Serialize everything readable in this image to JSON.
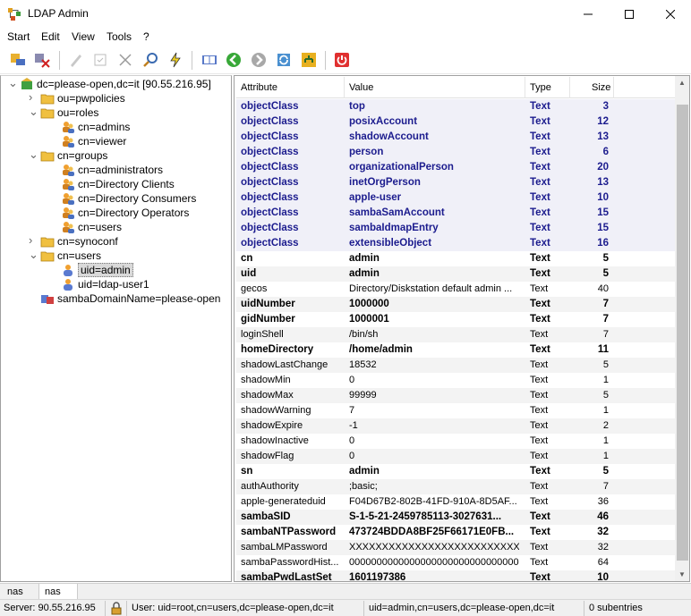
{
  "window": {
    "title": "LDAP Admin"
  },
  "menu": [
    "Start",
    "Edit",
    "View",
    "Tools",
    "?"
  ],
  "tree": [
    {
      "label": "dc=please-open,dc=it [90.55.216.95]",
      "level": 0,
      "toggle": "v",
      "icon": "domain-icon"
    },
    {
      "label": "ou=pwpolicies",
      "level": 1,
      "toggle": ">",
      "icon": "folder-icon"
    },
    {
      "label": "ou=roles",
      "level": 1,
      "toggle": "v",
      "icon": "folder-icon"
    },
    {
      "label": "cn=admins",
      "level": 2,
      "toggle": "",
      "icon": "group-icon"
    },
    {
      "label": "cn=viewer",
      "level": 2,
      "toggle": "",
      "icon": "group-icon"
    },
    {
      "label": "cn=groups",
      "level": 1,
      "toggle": "v",
      "icon": "folder-icon"
    },
    {
      "label": "cn=administrators",
      "level": 2,
      "toggle": "",
      "icon": "group-icon"
    },
    {
      "label": "cn=Directory Clients",
      "level": 2,
      "toggle": "",
      "icon": "group-icon"
    },
    {
      "label": "cn=Directory Consumers",
      "level": 2,
      "toggle": "",
      "icon": "group-icon"
    },
    {
      "label": "cn=Directory Operators",
      "level": 2,
      "toggle": "",
      "icon": "group-icon"
    },
    {
      "label": "cn=users",
      "level": 2,
      "toggle": "",
      "icon": "group-icon"
    },
    {
      "label": "cn=synoconf",
      "level": 1,
      "toggle": ">",
      "icon": "folder-icon"
    },
    {
      "label": "cn=users",
      "level": 1,
      "toggle": "v",
      "icon": "folder-icon"
    },
    {
      "label": "uid=admin",
      "level": 2,
      "toggle": "",
      "icon": "user-icon",
      "selected": true
    },
    {
      "label": "uid=ldap-user1",
      "level": 2,
      "toggle": "",
      "icon": "user-icon"
    },
    {
      "label": "sambaDomainName=please-open",
      "level": 1,
      "toggle": "",
      "icon": "samba-icon"
    }
  ],
  "grid": {
    "headers": {
      "attribute": "Attribute",
      "value": "Value",
      "type": "Type",
      "size": "Size"
    },
    "rows": [
      {
        "a": "objectClass",
        "v": "top",
        "t": "Text",
        "s": "3",
        "k": "oc"
      },
      {
        "a": "objectClass",
        "v": "posixAccount",
        "t": "Text",
        "s": "12",
        "k": "oc"
      },
      {
        "a": "objectClass",
        "v": "shadowAccount",
        "t": "Text",
        "s": "13",
        "k": "oc"
      },
      {
        "a": "objectClass",
        "v": "person",
        "t": "Text",
        "s": "6",
        "k": "oc"
      },
      {
        "a": "objectClass",
        "v": "organizationalPerson",
        "t": "Text",
        "s": "20",
        "k": "oc"
      },
      {
        "a": "objectClass",
        "v": "inetOrgPerson",
        "t": "Text",
        "s": "13",
        "k": "oc"
      },
      {
        "a": "objectClass",
        "v": "apple-user",
        "t": "Text",
        "s": "10",
        "k": "oc"
      },
      {
        "a": "objectClass",
        "v": "sambaSamAccount",
        "t": "Text",
        "s": "15",
        "k": "oc"
      },
      {
        "a": "objectClass",
        "v": "sambaIdmapEntry",
        "t": "Text",
        "s": "15",
        "k": "oc"
      },
      {
        "a": "objectClass",
        "v": "extensibleObject",
        "t": "Text",
        "s": "16",
        "k": "oc"
      },
      {
        "a": "cn",
        "v": "admin",
        "t": "Text",
        "s": "5",
        "k": "bold"
      },
      {
        "a": "uid",
        "v": "admin",
        "t": "Text",
        "s": "5",
        "k": "bold"
      },
      {
        "a": "gecos",
        "v": "Directory/Diskstation default admin ...",
        "t": "Text",
        "s": "40",
        "k": "normal"
      },
      {
        "a": "uidNumber",
        "v": "1000000",
        "t": "Text",
        "s": "7",
        "k": "bold"
      },
      {
        "a": "gidNumber",
        "v": "1000001",
        "t": "Text",
        "s": "7",
        "k": "bold"
      },
      {
        "a": "loginShell",
        "v": "/bin/sh",
        "t": "Text",
        "s": "7",
        "k": "normal"
      },
      {
        "a": "homeDirectory",
        "v": "/home/admin",
        "t": "Text",
        "s": "11",
        "k": "bold"
      },
      {
        "a": "shadowLastChange",
        "v": "18532",
        "t": "Text",
        "s": "5",
        "k": "normal"
      },
      {
        "a": "shadowMin",
        "v": "0",
        "t": "Text",
        "s": "1",
        "k": "normal"
      },
      {
        "a": "shadowMax",
        "v": "99999",
        "t": "Text",
        "s": "5",
        "k": "normal"
      },
      {
        "a": "shadowWarning",
        "v": "7",
        "t": "Text",
        "s": "1",
        "k": "normal"
      },
      {
        "a": "shadowExpire",
        "v": "-1",
        "t": "Text",
        "s": "2",
        "k": "normal"
      },
      {
        "a": "shadowInactive",
        "v": "0",
        "t": "Text",
        "s": "1",
        "k": "normal"
      },
      {
        "a": "shadowFlag",
        "v": "0",
        "t": "Text",
        "s": "1",
        "k": "normal"
      },
      {
        "a": "sn",
        "v": "admin",
        "t": "Text",
        "s": "5",
        "k": "bold"
      },
      {
        "a": "authAuthority",
        "v": ";basic;",
        "t": "Text",
        "s": "7",
        "k": "normal"
      },
      {
        "a": "apple-generateduid",
        "v": "F04D67B2-802B-41FD-910A-8D5AF...",
        "t": "Text",
        "s": "36",
        "k": "normal"
      },
      {
        "a": "sambaSID",
        "v": "S-1-5-21-2459785113-3027631...",
        "t": "Text",
        "s": "46",
        "k": "bold"
      },
      {
        "a": "sambaNTPassword",
        "v": "473724BDDA8BF25F66171E0FB...",
        "t": "Text",
        "s": "32",
        "k": "bold"
      },
      {
        "a": "sambaLMPassword",
        "v": "XXXXXXXXXXXXXXXXXXXXXXXXXXXXXXXX",
        "t": "Text",
        "s": "32",
        "k": "normal"
      },
      {
        "a": "sambaPasswordHist...",
        "v": "0000000000000000000000000000000000",
        "t": "Text",
        "s": "64",
        "k": "normal"
      },
      {
        "a": "sambaPwdLastSet",
        "v": "1601197386",
        "t": "Text",
        "s": "10",
        "k": "bold"
      }
    ]
  },
  "tabs": [
    "nas",
    "nas"
  ],
  "status": {
    "server": "Server: 90.55.216.95",
    "user": "User: uid=root,cn=users,dc=please-open,dc=it",
    "dn": "uid=admin,cn=users,dc=please-open,dc=it",
    "subentries": "0 subentries"
  }
}
